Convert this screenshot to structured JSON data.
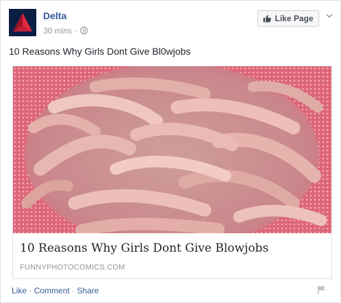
{
  "post": {
    "page_name": "Delta",
    "timestamp": "30 mins",
    "separator": "·",
    "like_page_label": "Like Page",
    "text": "10 Reasons Why Girls Dont Give Bl0wjobs"
  },
  "link": {
    "title": "10 Reasons Why Girls Dont Give Blowjobs",
    "domain": "FUNNYPHOTOCOMICS.COM"
  },
  "actions": {
    "like": "Like",
    "comment": "Comment",
    "share": "Share",
    "separator": "·"
  },
  "icons": [
    "thumbs-up-icon",
    "globe-icon",
    "chevron-down-icon",
    "flag-icon"
  ],
  "colors": {
    "link_blue": "#365899",
    "meta_gray": "#90949c",
    "brand_red": "#e01933"
  }
}
